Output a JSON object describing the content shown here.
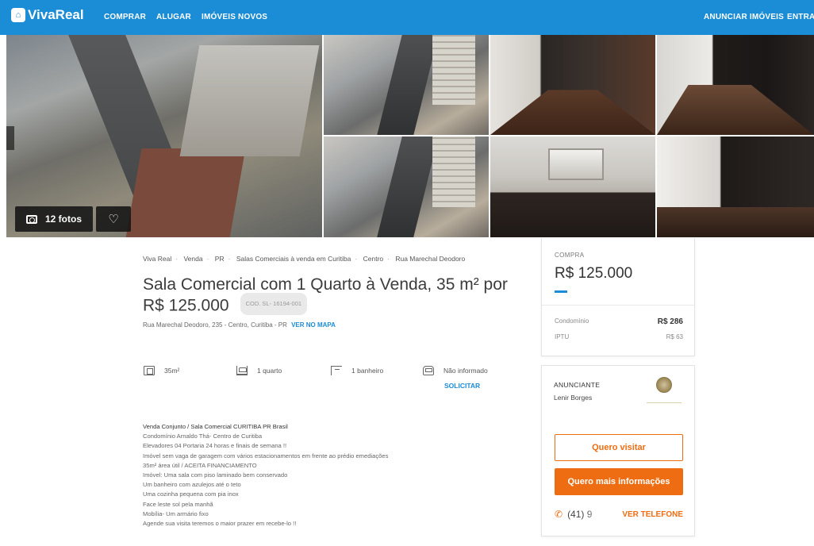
{
  "header": {
    "logo_text": "VivaReal",
    "nav": [
      "COMPRAR",
      "ALUGAR",
      "IMÓVEIS NOVOS"
    ],
    "right_nav": [
      "ANUNCIAR IMÓVEIS",
      "ENTRAR"
    ],
    "brand_color": "#1b8cd6"
  },
  "gallery": {
    "photos_label": "12 fotos",
    "photo_icon": "camera-icon",
    "favorite_icon": "heart-icon"
  },
  "breadcrumb": [
    "Viva Real",
    "Venda",
    "PR",
    "Salas Comerciais à venda em Curitiba",
    "Centro",
    "Rua Marechal Deodoro"
  ],
  "listing": {
    "title": "Sala Comercial com 1 Quarto à Venda, 35 m² por R$ 125.000",
    "code": "COD. SL- 16194-001",
    "address": "Rua Marechal Deodoro, 235 - Centro, Curitiba - PR",
    "map_link": "VER NO MAPA"
  },
  "features": {
    "area": "35m²",
    "rooms": "1 quarto",
    "bathrooms": "1 banheiro",
    "parking": "Não informado",
    "request_link": "SOLICITAR"
  },
  "description": {
    "title": "Venda Conjunto / Sala Comercial CURITIBA PR Brasil",
    "lines": [
      "Condomínio Arnaldo Thá- Centro de Curitiba",
      "Elevadores 04 Portaria 24 horas e finais de semana !!",
      "Imóvel sem vaga de garagem com vários estacionamentos em frente ao prédio emediações",
      "35m² área útil / ACEITA FINANCIAMENTO",
      "Imóvel: Uma sala com piso laminado bem conservado",
      "Um banheiro com azulejos até o teto",
      "Uma cozinha pequena com pia inox",
      "Face leste sol pela manhã",
      "Mobília- Um armário fixo",
      "Agende sua visita teremos o maior prazer em recebe-lo !!"
    ]
  },
  "price": {
    "label": "COMPRA",
    "value": "R$ 125.000",
    "condo_label": "Condomínio",
    "condo_value": "R$ 286",
    "iptu_label": "IPTU",
    "iptu_value": "R$ 63"
  },
  "advertiser": {
    "label": "ANUNCIANTE",
    "name": "Lenir Borges",
    "visit_button": "Quero visitar",
    "info_button": "Quero mais informações",
    "phone": "(41) 9",
    "phone_link": "VER TELEFONE",
    "accent_color": "#ee6d12"
  }
}
